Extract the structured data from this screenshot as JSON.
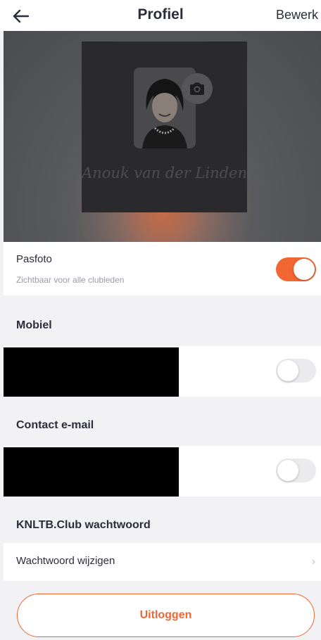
{
  "header": {
    "title": "Profiel",
    "edit_label": "Bewerk",
    "back_icon": "arrow-left-icon"
  },
  "hero": {
    "name": "Anouk van der Linden",
    "camera_icon": "camera-icon"
  },
  "pasfoto": {
    "title": "Pasfoto",
    "subtitle": "Zichtbaar voor alle clubleden",
    "enabled": true
  },
  "mobile": {
    "label": "Mobiel",
    "visible": false
  },
  "email": {
    "label": "Contact e-mail",
    "visible": false
  },
  "password": {
    "section_label": "KNLTB.Club wachtwoord",
    "change_label": "Wachtwoord wijzigen",
    "chevron": "›"
  },
  "logout_label": "Uitloggen",
  "colors": {
    "accent": "#f26633",
    "background": "#f2f2f4",
    "text": "#2b2d3a"
  }
}
